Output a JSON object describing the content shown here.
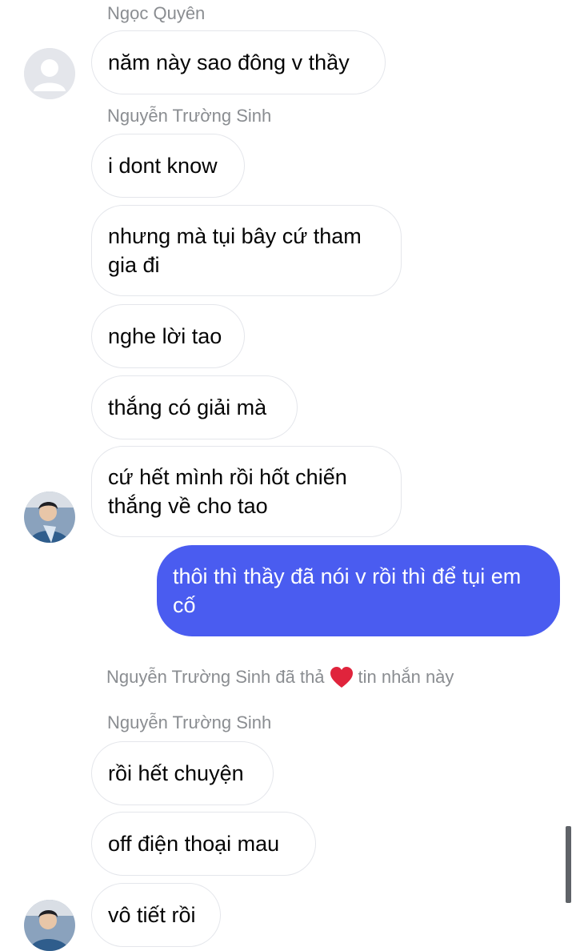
{
  "groups": [
    {
      "sender": "Ngọc Quyên"
    },
    {
      "sender": "Nguyễn Trường Sinh"
    },
    {
      "sender": "Nguyễn Trường Sinh"
    }
  ],
  "messages": [
    {
      "text": "năm này sao đông v thầy"
    },
    {
      "text": "i dont know"
    },
    {
      "text": "nhưng mà tụi bây cứ tham gia đi"
    },
    {
      "text": "nghe lời tao"
    },
    {
      "text": "thắng có giải mà"
    },
    {
      "text": "cứ hết mình rồi hốt chiến thắng về cho tao"
    },
    {
      "text": "thôi thì thầy đã nói v rồi thì để tụi em cố"
    },
    {
      "text": "rồi hết chuyện"
    },
    {
      "text": "off điện thoại mau"
    },
    {
      "text": "vô tiết rồi"
    }
  ],
  "reaction": {
    "prefix": "Nguyễn Trường Sinh đã thả",
    "icon": "heart-icon",
    "suffix": "tin nhắn này",
    "color": "#e0243c"
  },
  "colors": {
    "sent_bubble": "#4a5cf0",
    "received_border": "#e4e6eb",
    "meta_text": "#8a8d91"
  }
}
